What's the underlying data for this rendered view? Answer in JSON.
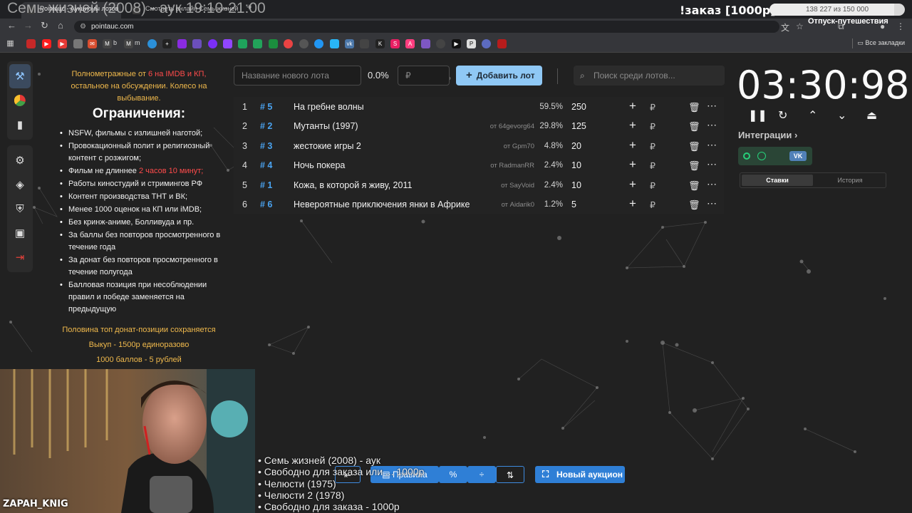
{
  "overlay_title": "Семь жизней (2008) - аук 19:10-21:00",
  "tabs": [
    {
      "label": "Pointauc - Аукционы лотов"
    },
    {
      "label": "Смотреть онлайн Семь жизней"
    }
  ],
  "stream_goal": {
    "label": "!заказ [1000р]",
    "progress_text": "138 227 из 150 000",
    "fraction": 0.92,
    "caption": "Отпуск-путешествия"
  },
  "address_bar": {
    "url": "pointauc.com"
  },
  "bookmarks": {
    "all_label": "Все закладки",
    "items": [
      "b",
      "m"
    ]
  },
  "rules": {
    "intro_prefix": "Полнометражные от",
    "intro_red": "6 на IMDB и КП,",
    "intro_suffix": "остальное на обсуждении. Колесо на выбывание.",
    "heading": "Ограничения:",
    "items": [
      "NSFW, фильмы с излишней наготой;",
      "Провокационный полит и религиозный контент с розжигом;",
      "Фильм не длиннее ",
      "Работы киностудий и стримингов РФ",
      "Контент производства ТНТ и ВК;",
      "Менее 1000 оценок на КП или iMDB;",
      "Без кринж-аниме, Болливуда и пр.",
      "За баллы без повторов просмотренного в течение года",
      "За донат без повторов просмотренного в течение полугода",
      "Балловая позиция при несоблюдении правил и победе заменяется на предыдущую"
    ],
    "length_red": "2 часов 10 минут;",
    "footer": [
      "Половина топ донат-позиции сохраняется",
      "Выкуп - 1500р единоразово",
      "1000 баллов - 5 рублей"
    ]
  },
  "controls": {
    "lot_name_placeholder": "Название нового лота",
    "percent": "0.0%",
    "rub_placeholder": "₽",
    "add_button": "Добавить лот",
    "search_placeholder": "Поиск среди лотов..."
  },
  "lots": [
    {
      "num": "1",
      "id": "# 5",
      "name": "На гребне волны",
      "by": "",
      "pct": "59.5%",
      "amount": "250"
    },
    {
      "num": "2",
      "id": "# 2",
      "name": "Мутанты (1997)",
      "by": "от 64gevorg64",
      "pct": "29.8%",
      "amount": "125"
    },
    {
      "num": "3",
      "id": "# 3",
      "name": "жестокие игры 2",
      "by": "от Gpm70",
      "pct": "4.8%",
      "amount": "20"
    },
    {
      "num": "4",
      "id": "# 4",
      "name": "Ночь покера",
      "by": "от RadmanRR",
      "pct": "2.4%",
      "amount": "10"
    },
    {
      "num": "5",
      "id": "# 1",
      "name": "Кожа, в которой я живу, 2011",
      "by": "от SayVoid",
      "pct": "2.4%",
      "amount": "10"
    },
    {
      "num": "6",
      "id": "# 6",
      "name": "Невероятные приключения янки в Африке",
      "by": "от Aidarik0",
      "pct": "1.2%",
      "amount": "5"
    }
  ],
  "timer": "03:30:98",
  "integrations_label": "Интеграции",
  "integration_vk": "VK",
  "tabs_right": {
    "bets": "Ставки",
    "history": "История"
  },
  "bottom": {
    "rules_label": "Правила",
    "new_auction": "Новый аукцион"
  },
  "queue": [
    "• Семь жизней (2008) - аук",
    "• Свободно для заказа или ... 1000р",
    "• Челюсти (1975)",
    "• Челюсти 2 (1978)",
    "• Свободно для заказа - 1000р"
  ],
  "streamer_name": "ZAPAH_KNIG"
}
